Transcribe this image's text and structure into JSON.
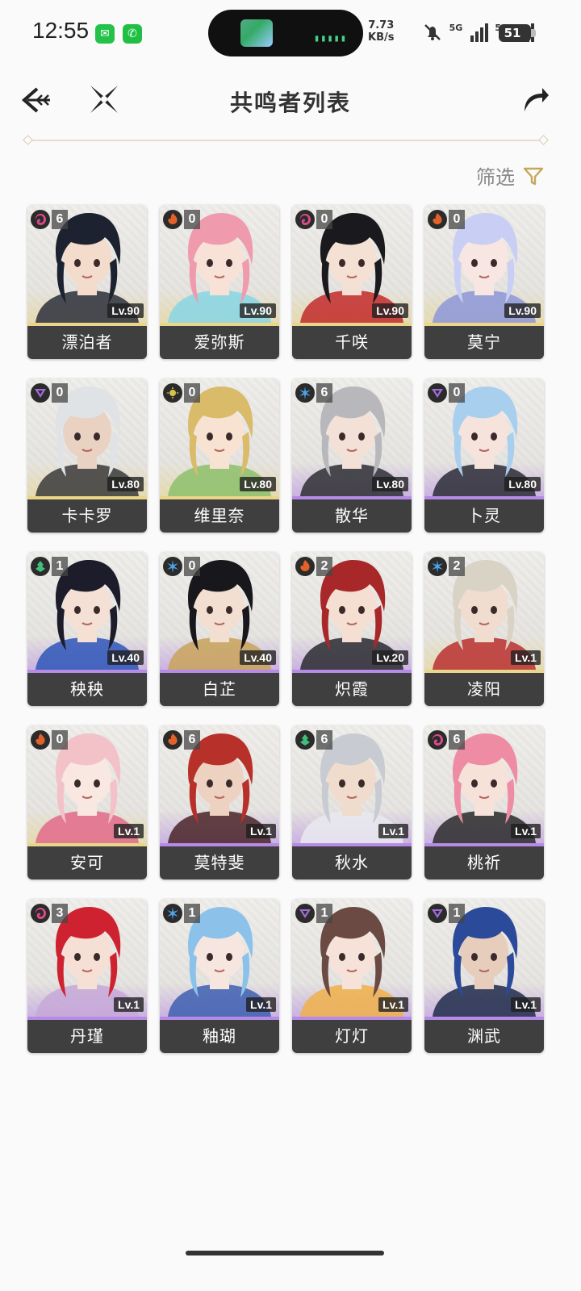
{
  "status_bar": {
    "time": "12:55",
    "net_speed_value": "7.73",
    "net_speed_unit": "KB/s",
    "sim1": "5G",
    "sim2": "5G",
    "battery": "51",
    "apps": [
      "messages-icon",
      "wechat-icon"
    ]
  },
  "header": {
    "title": "共鸣者列表",
    "back_icon": "back-arrow-icon",
    "close_icon": "close-x-icon",
    "share_icon": "share-arrow-icon"
  },
  "filter": {
    "label": "筛选",
    "icon": "filter-funnel-icon"
  },
  "colors": {
    "gold": "#c6a85a",
    "five_star": "#e9d68a",
    "four_star": "#b68be6",
    "name_plate": "#3f3f3f",
    "fusion": "#e0612a",
    "aero": "#3fbf7a",
    "glacio": "#4aa3e8",
    "electro": "#a06cd8",
    "spectro": "#d9c24a",
    "havoc": "#d94a8a"
  },
  "characters": [
    {
      "name": "漂泊者",
      "level": "Lv.90",
      "sequence": "6",
      "element": "havoc",
      "rarity": 5,
      "hair": "#1d2230",
      "skin": "#f3dccb",
      "accent": "#2b2f3b"
    },
    {
      "name": "爱弥斯",
      "level": "Lv.90",
      "sequence": "0",
      "element": "fusion",
      "rarity": 5,
      "hair": "#f09aae",
      "skin": "#f8e2d8",
      "accent": "#87d6e4"
    },
    {
      "name": "千咲",
      "level": "Lv.90",
      "sequence": "0",
      "element": "havoc",
      "rarity": 5,
      "hair": "#1a1a1e",
      "skin": "#f5e0d4",
      "accent": "#c22a2a"
    },
    {
      "name": "莫宁",
      "level": "Lv.90",
      "sequence": "0",
      "element": "fusion",
      "rarity": 5,
      "hair": "#c9cff4",
      "skin": "#f7e6e2",
      "accent": "#8d96d8"
    },
    {
      "name": "卡卡罗",
      "level": "Lv.80",
      "sequence": "0",
      "element": "electro",
      "rarity": 5,
      "hair": "#dfe3e6",
      "skin": "#e9d2c2",
      "accent": "#3a3a3a"
    },
    {
      "name": "维里奈",
      "level": "Lv.80",
      "sequence": "0",
      "element": "spectro",
      "rarity": 5,
      "hair": "#d9bb6a",
      "skin": "#f8e3d2",
      "accent": "#8cc06a"
    },
    {
      "name": "散华",
      "level": "Lv.80",
      "sequence": "6",
      "element": "glacio",
      "rarity": 4,
      "hair": "#b8b8bc",
      "skin": "#f3e0d6",
      "accent": "#2e2e34"
    },
    {
      "name": "卜灵",
      "level": "Lv.80",
      "sequence": "0",
      "element": "electro",
      "rarity": 4,
      "hair": "#a9cfee",
      "skin": "#f6e4dc",
      "accent": "#2b2b36"
    },
    {
      "name": "秧秧",
      "level": "Lv.40",
      "sequence": "1",
      "element": "aero",
      "rarity": 4,
      "hair": "#1c1c2a",
      "skin": "#f4e0d4",
      "accent": "#2e56b8"
    },
    {
      "name": "白芷",
      "level": "Lv.40",
      "sequence": "0",
      "element": "glacio",
      "rarity": 4,
      "hair": "#18181c",
      "skin": "#f2dfd2",
      "accent": "#c9a35a"
    },
    {
      "name": "炽霞",
      "level": "Lv.20",
      "sequence": "2",
      "element": "fusion",
      "rarity": 4,
      "hair": "#a8282a",
      "skin": "#f5ded2",
      "accent": "#2a2a30"
    },
    {
      "name": "凌阳",
      "level": "Lv.1",
      "sequence": "2",
      "element": "glacio",
      "rarity": 5,
      "hair": "#d9d3c6",
      "skin": "#f1dcd0",
      "accent": "#b83030"
    },
    {
      "name": "安可",
      "level": "Lv.1",
      "sequence": "0",
      "element": "fusion",
      "rarity": 5,
      "hair": "#f2c2c8",
      "skin": "#f9e8e2",
      "accent": "#e26a8a"
    },
    {
      "name": "莫特斐",
      "level": "Lv.1",
      "sequence": "6",
      "element": "fusion",
      "rarity": 4,
      "hair": "#b8302a",
      "skin": "#edd2c2",
      "accent": "#4a2428"
    },
    {
      "name": "秋水",
      "level": "Lv.1",
      "sequence": "6",
      "element": "aero",
      "rarity": 4,
      "hair": "#c8ccd2",
      "skin": "#f0dccc",
      "accent": "#e9e9ee"
    },
    {
      "name": "桃祈",
      "level": "Lv.1",
      "sequence": "6",
      "element": "havoc",
      "rarity": 4,
      "hair": "#ee8ca4",
      "skin": "#f7e2da",
      "accent": "#2a2a2a"
    },
    {
      "name": "丹瑾",
      "level": "Lv.1",
      "sequence": "3",
      "element": "havoc",
      "rarity": 4,
      "hair": "#cf2230",
      "skin": "#f6e0d6",
      "accent": "#c7a8d8"
    },
    {
      "name": "釉瑚",
      "level": "Lv.1",
      "sequence": "1",
      "element": "glacio",
      "rarity": 4,
      "hair": "#8cc2ea",
      "skin": "#f7e6e0",
      "accent": "#3d5fb0"
    },
    {
      "name": "灯灯",
      "level": "Lv.1",
      "sequence": "1",
      "element": "electro",
      "rarity": 4,
      "hair": "#6a4a42",
      "skin": "#f6e2d8",
      "accent": "#f0b04a"
    },
    {
      "name": "渊武",
      "level": "Lv.1",
      "sequence": "1",
      "element": "electro",
      "rarity": 4,
      "hair": "#2b4a9a",
      "skin": "#e7cdbb",
      "accent": "#1f2a4a"
    }
  ]
}
